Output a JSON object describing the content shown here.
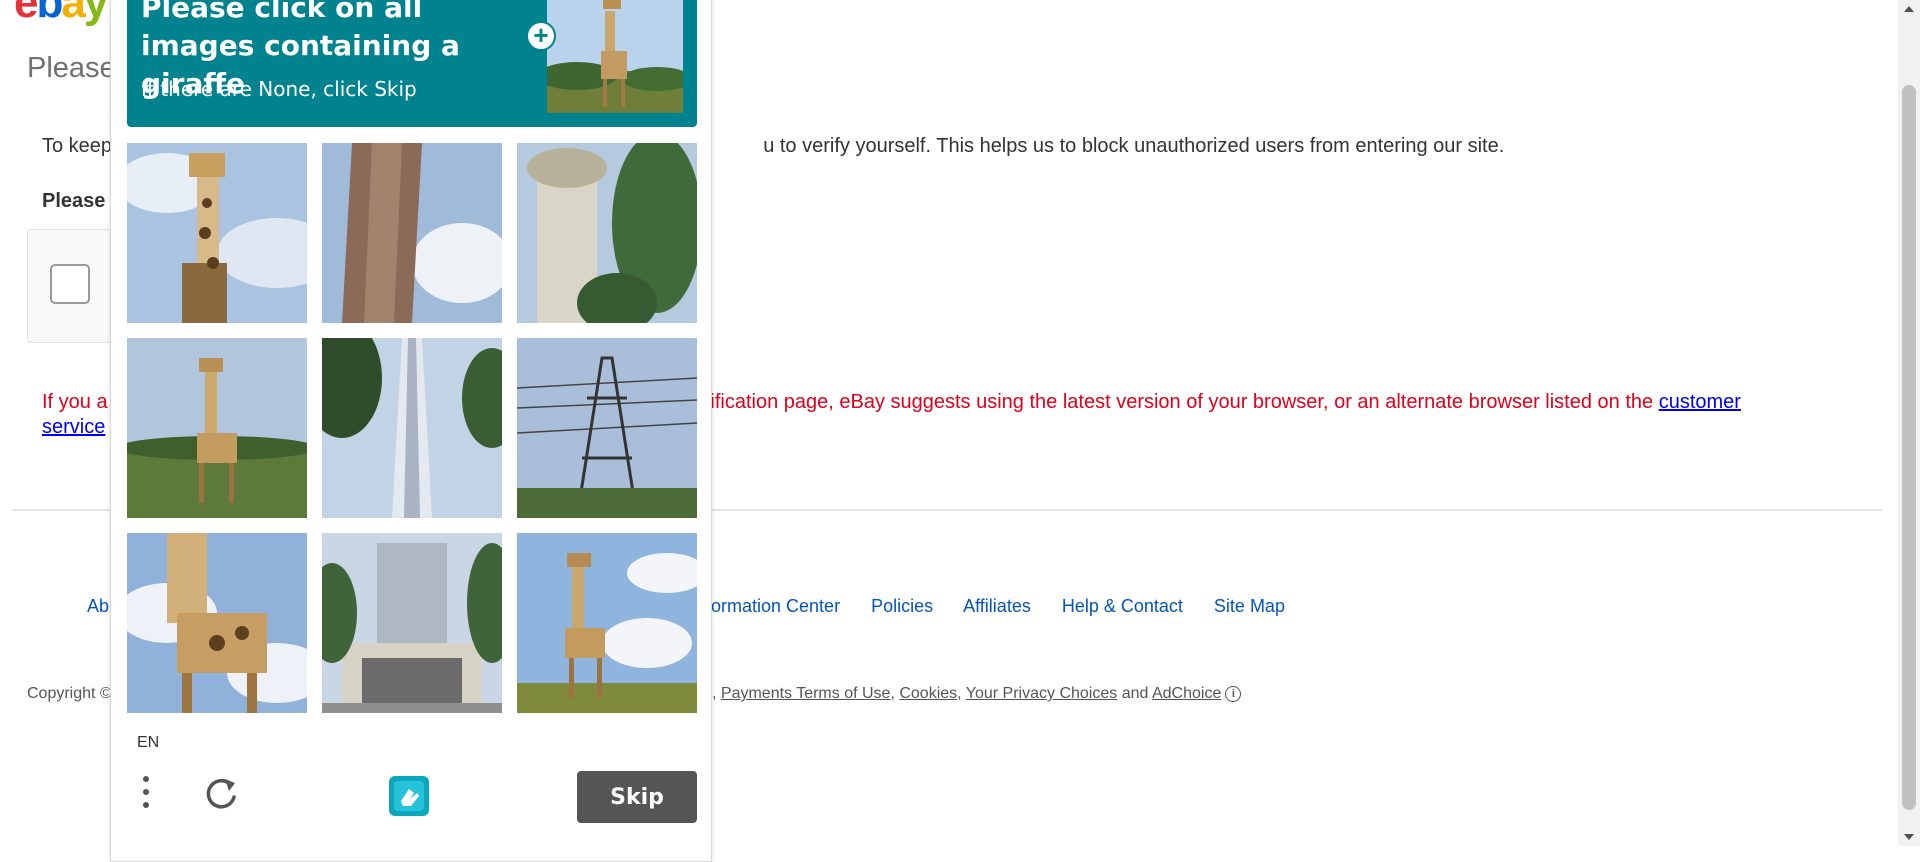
{
  "page": {
    "logo": {
      "l1": "e",
      "l2": "b",
      "l3": "a",
      "l4": "y"
    },
    "heading": "Please",
    "intro_left": "To keep",
    "intro_right": "u to verify yourself. This helps us to block unauthorized users from entering our site.",
    "please_label": "Please",
    "warning_left": "If you a",
    "warning_right": "erification page, eBay suggests using the latest version of your browser, or an alternate browser listed on the ",
    "warning_link": "customer",
    "warning_link2": "service",
    "footer_left": "Ab",
    "footer_links": [
      "formation Center",
      "Policies",
      "Affiliates",
      "Help & Contact",
      "Site Map"
    ],
    "copyright_left": "Copyright ©",
    "copyright_comma": ",",
    "copyright_links": {
      "payments": "Payments Terms of Use",
      "cookies": "Cookies",
      "privacy": "Your Privacy Choices",
      "and": "and",
      "adchoice": "AdChoice"
    }
  },
  "captcha": {
    "prompt": "Please click on all images containing a giraffe",
    "sub": "If there are None, click Skip",
    "language": "EN",
    "skip_label": "Skip",
    "accent_color": "#00838f",
    "tiles": [
      {
        "row": 0,
        "col": 0,
        "subject": "giraffe"
      },
      {
        "row": 0,
        "col": 1,
        "subject": "tree-trunk"
      },
      {
        "row": 0,
        "col": 2,
        "subject": "trees"
      },
      {
        "row": 1,
        "col": 0,
        "subject": "giraffe"
      },
      {
        "row": 1,
        "col": 1,
        "subject": "skyscraper"
      },
      {
        "row": 1,
        "col": 2,
        "subject": "power-tower"
      },
      {
        "row": 2,
        "col": 0,
        "subject": "giraffe"
      },
      {
        "row": 2,
        "col": 1,
        "subject": "building"
      },
      {
        "row": 2,
        "col": 2,
        "subject": "giraffe"
      }
    ]
  }
}
